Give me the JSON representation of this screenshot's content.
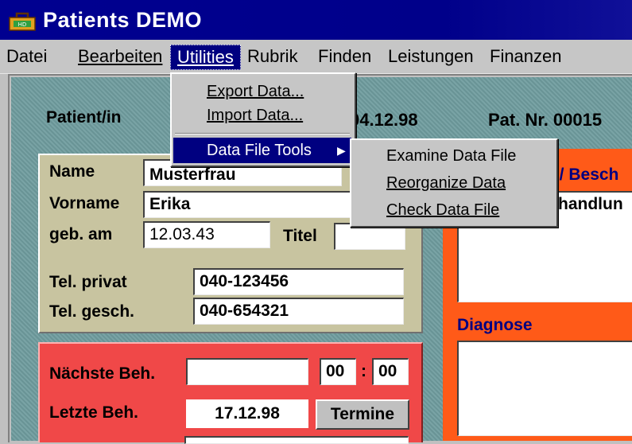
{
  "window": {
    "title": "Patients DEMO"
  },
  "menubar": {
    "items": [
      "Datei",
      "Bearbeiten",
      "Utilities",
      "Rubrik",
      "Finden",
      "Leistungen",
      "Finanzen"
    ]
  },
  "utilities_menu": {
    "export": "Export Data...",
    "import": "Import Data...",
    "data_file_tools": "Data File Tools",
    "arrow": "▶"
  },
  "data_file_tools_menu": {
    "examine": "Examine Data File",
    "reorganize": "Reorganize Data",
    "check": "Check Data File"
  },
  "header": {
    "patient_label": "Patient/in",
    "date": "04.12.98",
    "pat_nr_label": "Pat. Nr. 00015"
  },
  "personal": {
    "name_label": "Name",
    "name_value": "Musterfrau",
    "vorname_label": "Vorname",
    "vorname_value": "Erika",
    "geb_label": "geb. am",
    "geb_value": "12.03.43",
    "titel_label": "Titel",
    "titel_value": "",
    "tel_privat_label": "Tel. privat",
    "tel_privat_value": "040-123456",
    "tel_gesch_label": "Tel. gesch.",
    "tel_gesch_value": "040-654321"
  },
  "appointments": {
    "naechste_label": "Nächste Beh.",
    "naechste_value": "",
    "hour": "00",
    "colon": ":",
    "minute": "00",
    "letzte_label": "Letzte Beh.",
    "letzte_value": "17.12.98",
    "termine_button": "Termine"
  },
  "right_panel": {
    "header_partial": "e/ Besch",
    "behandlung_partial": "handlun",
    "diagnose_label": "Diagnose"
  }
}
